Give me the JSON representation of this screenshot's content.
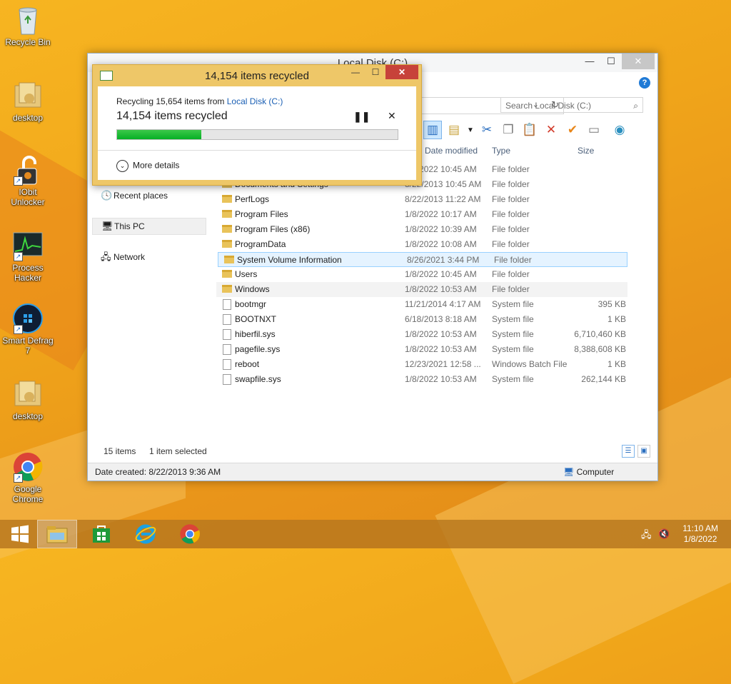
{
  "desktop": {
    "icons": [
      {
        "label": "Recycle Bin",
        "icon": "recycle-bin-icon"
      },
      {
        "label": "desktop",
        "icon": "folder-desktop-icon"
      },
      {
        "label": "IObit\nUnlocker",
        "icon": "iobit-unlocker-icon"
      },
      {
        "label": "Process\nHacker",
        "icon": "process-hacker-icon"
      },
      {
        "label": "Smart Defrag\n7",
        "icon": "smart-defrag-icon"
      },
      {
        "label": "desktop",
        "icon": "folder-desktop-icon"
      },
      {
        "label": "Google\nChrome",
        "icon": "chrome-icon"
      }
    ]
  },
  "explorer": {
    "title": "Local Disk (C:)",
    "search_placeholder": "Search Local Disk (C:)",
    "columns": {
      "date": "Date modified",
      "type": "Type",
      "size": "Size"
    },
    "nav": {
      "recent": "Recent places",
      "this_pc": "This PC",
      "network": "Network"
    },
    "rows": [
      {
        "name": "",
        "date": "1/8/2022 10:45 AM",
        "type": "File folder",
        "size": "",
        "kind": "folder"
      },
      {
        "name": "Documents and Settings",
        "date": "8/22/2013 10:45 AM",
        "type": "File folder",
        "size": "",
        "kind": "folder"
      },
      {
        "name": "PerfLogs",
        "date": "8/22/2013 11:22 AM",
        "type": "File folder",
        "size": "",
        "kind": "folder"
      },
      {
        "name": "Program Files",
        "date": "1/8/2022 10:17 AM",
        "type": "File folder",
        "size": "",
        "kind": "folder"
      },
      {
        "name": "Program Files (x86)",
        "date": "1/8/2022 10:39 AM",
        "type": "File folder",
        "size": "",
        "kind": "folder"
      },
      {
        "name": "ProgramData",
        "date": "1/8/2022 10:08 AM",
        "type": "File folder",
        "size": "",
        "kind": "folder"
      },
      {
        "name": "System Volume Information",
        "date": "8/26/2021 3:44 PM",
        "type": "File folder",
        "size": "",
        "kind": "folder"
      },
      {
        "name": "Users",
        "date": "1/8/2022 10:45 AM",
        "type": "File folder",
        "size": "",
        "kind": "folder"
      },
      {
        "name": "Windows",
        "date": "1/8/2022 10:53 AM",
        "type": "File folder",
        "size": "",
        "kind": "folder"
      },
      {
        "name": "bootmgr",
        "date": "11/21/2014 4:17 AM",
        "type": "System file",
        "size": "395 KB",
        "kind": "file"
      },
      {
        "name": "BOOTNXT",
        "date": "6/18/2013 8:18 AM",
        "type": "System file",
        "size": "1 KB",
        "kind": "file"
      },
      {
        "name": "hiberfil.sys",
        "date": "1/8/2022 10:53 AM",
        "type": "System file",
        "size": "6,710,460 KB",
        "kind": "file"
      },
      {
        "name": "pagefile.sys",
        "date": "1/8/2022 10:53 AM",
        "type": "System file",
        "size": "8,388,608 KB",
        "kind": "file"
      },
      {
        "name": "reboot",
        "date": "12/23/2021 12:58 ...",
        "type": "Windows Batch File",
        "size": "1 KB",
        "kind": "file"
      },
      {
        "name": "swapfile.sys",
        "date": "1/8/2022 10:53 AM",
        "type": "System file",
        "size": "262,144 KB",
        "kind": "file"
      }
    ],
    "item_count": "15 items",
    "selection": "1 item selected",
    "status_left": "Date created: 8/22/2013 9:36 AM",
    "status_right": "Computer"
  },
  "dialog": {
    "title": "14,154 items recycled",
    "line1_prefix": "Recycling 15,654 items from ",
    "line1_link": "Local Disk (C:)",
    "line2": "14,154 items recycled",
    "progress": 0.3,
    "more_details": "More details"
  },
  "taskbar": {
    "time": "11:10 AM",
    "date": "1/8/2022"
  }
}
